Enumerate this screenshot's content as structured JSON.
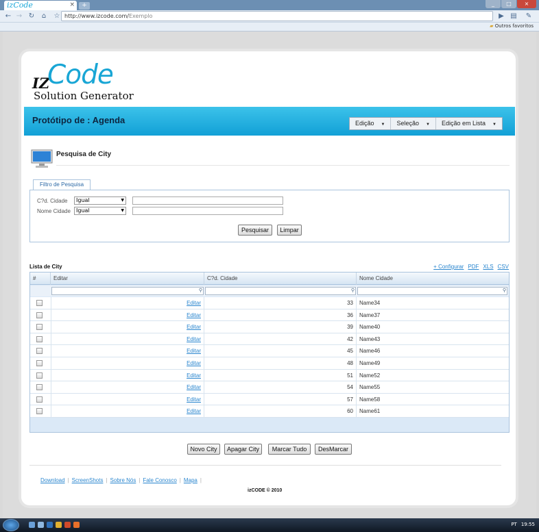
{
  "browser": {
    "tab_logo": "izCode",
    "tab_close": "×",
    "new_tab": "+",
    "url_host": "http://www.izcode.com/",
    "url_path": "Exemplo",
    "bookmark_folder": "Outros favoritos",
    "window_buttons": [
      "_",
      "□",
      "×"
    ]
  },
  "brand": {
    "iz": "IZ",
    "code": "Code",
    "subtitle": "Solution Generator"
  },
  "header": {
    "title": "Protótipo de : Agenda",
    "menu": [
      "Edição",
      "Seleção",
      "Edição em Lista"
    ]
  },
  "section": {
    "title": "Pesquisa de City"
  },
  "filter": {
    "tab_label": "Filtro de Pesquisa",
    "rows": [
      {
        "label": "C?d. Cidade",
        "operator": "Igual",
        "value": ""
      },
      {
        "label": "Nome Cidade",
        "operator": "Igual",
        "value": ""
      }
    ],
    "search_button": "Pesquisar",
    "clear_button": "Limpar"
  },
  "list": {
    "title": "Lista de City",
    "links": [
      "+ Configurar",
      "PDF",
      "XLS",
      "CSV"
    ],
    "columns": [
      "#",
      "Editar",
      "C?d. Cidade",
      "Nome Cidade"
    ],
    "rows": [
      {
        "edit": "Editar",
        "code": "33",
        "name": "Name34"
      },
      {
        "edit": "Editar",
        "code": "36",
        "name": "Name37"
      },
      {
        "edit": "Editar",
        "code": "39",
        "name": "Name40"
      },
      {
        "edit": "Editar",
        "code": "42",
        "name": "Name43"
      },
      {
        "edit": "Editar",
        "code": "45",
        "name": "Name46"
      },
      {
        "edit": "Editar",
        "code": "48",
        "name": "Name49"
      },
      {
        "edit": "Editar",
        "code": "51",
        "name": "Name52"
      },
      {
        "edit": "Editar",
        "code": "54",
        "name": "Name55"
      },
      {
        "edit": "Editar",
        "code": "57",
        "name": "Name58"
      },
      {
        "edit": "Editar",
        "code": "60",
        "name": "Name61"
      }
    ]
  },
  "actions": {
    "new": "Novo City",
    "delete": "Apagar City",
    "mark_all": "Marcar Tudo",
    "unmark": "DesMarcar"
  },
  "footer": {
    "links": [
      "Download",
      "ScreenShots",
      "Sobre Nós",
      "Fale Conosco",
      "Mapa"
    ],
    "copyright": "izCODE © 2010"
  },
  "taskbar": {
    "language": "PT",
    "clock": "19:55"
  },
  "colors": {
    "accent": "#19a6d5",
    "bar": "#12a0d6",
    "link": "#2a86cf",
    "grid_border": "#a9c3dd"
  }
}
